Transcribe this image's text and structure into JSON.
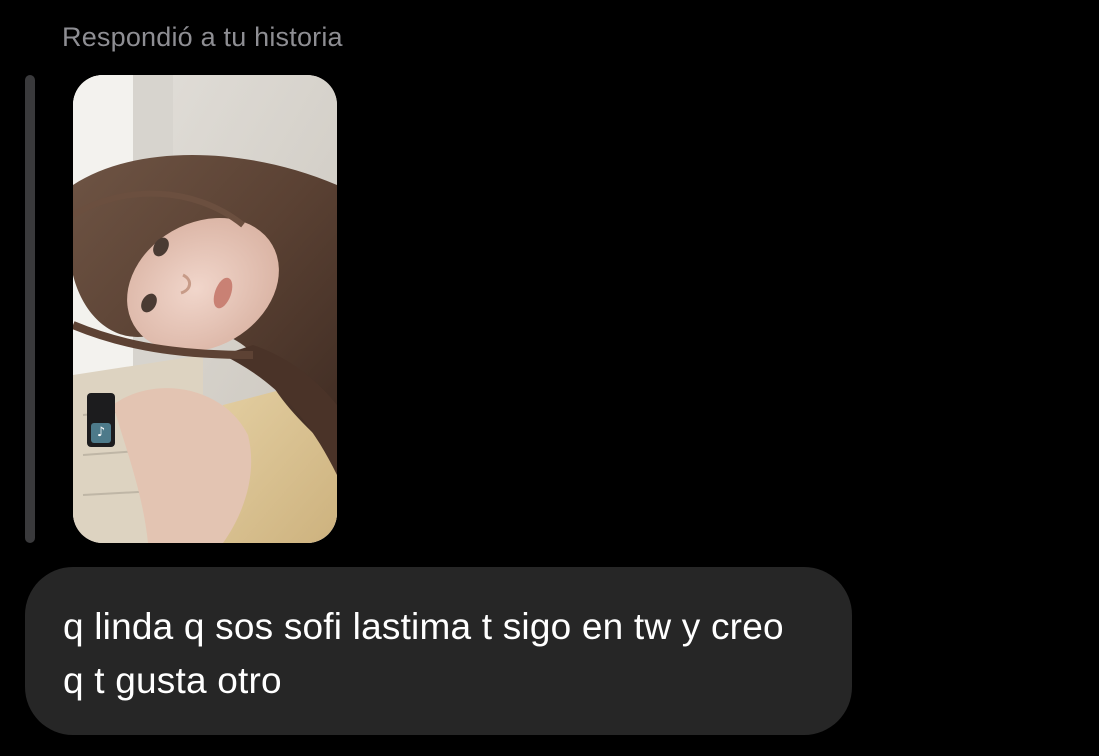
{
  "thread": {
    "reply_header": "Respondió a tu historia",
    "message_text": "q linda q sos sofi lastima t sigo en tw y creo q t gusta otro"
  },
  "story": {
    "image": "selfie-story-thumbnail",
    "music_sticker_icon": "music-note-icon"
  },
  "colors": {
    "background": "#000000",
    "header_text": "#8e8e93",
    "reply_bar": "#3a3a3c",
    "bubble": "#262626",
    "message_text": "#ffffff"
  }
}
